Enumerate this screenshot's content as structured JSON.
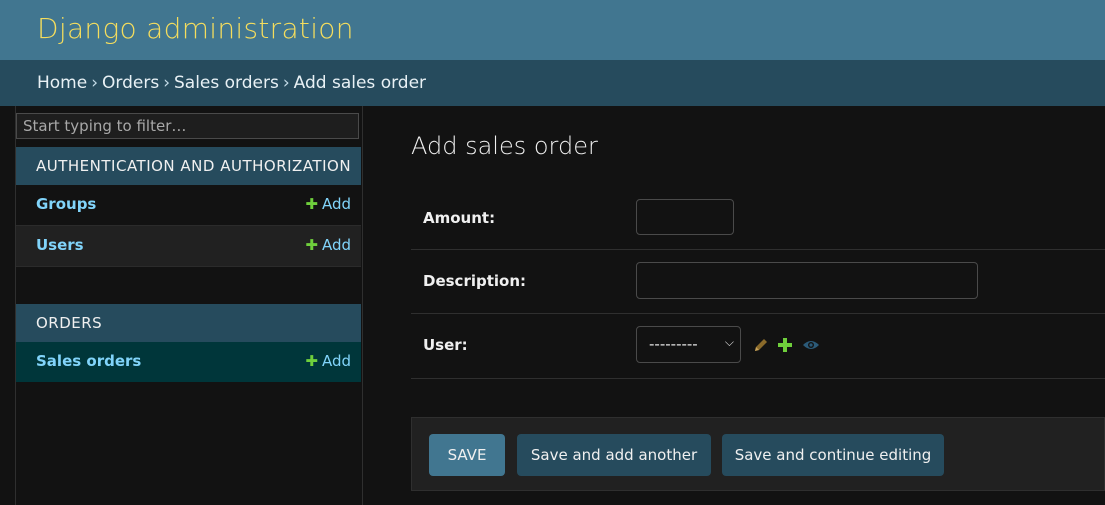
{
  "header": {
    "site_title": "Django administration"
  },
  "breadcrumbs": {
    "items": [
      "Home",
      "Orders",
      "Sales orders"
    ],
    "separator": "›",
    "current": "Add sales order"
  },
  "sidebar": {
    "filter_placeholder": "Start typing to filter…",
    "apps": [
      {
        "caption": "AUTHENTICATION AND AUTHORIZATION",
        "models": [
          {
            "name": "Groups",
            "add_label": "Add"
          },
          {
            "name": "Users",
            "add_label": "Add"
          }
        ]
      },
      {
        "caption": "ORDERS",
        "models": [
          {
            "name": "Sales orders",
            "add_label": "Add"
          }
        ]
      }
    ]
  },
  "main": {
    "title": "Add sales order",
    "fields": [
      {
        "label": "Amount:",
        "value": ""
      },
      {
        "label": "Description:",
        "value": ""
      },
      {
        "label": "User:",
        "value": "---------"
      }
    ],
    "buttons": {
      "save": "SAVE",
      "save_add_another": "Save and add another",
      "save_continue": "Save and continue editing"
    }
  },
  "colors": {
    "header_bg": "#417690",
    "breadcrumb_bg": "#264b5d",
    "accent_yellow": "#f5dd5d",
    "link_blue": "#81d4fa",
    "add_green": "#6fcf3c",
    "selected_row_bg": "#00363a"
  }
}
